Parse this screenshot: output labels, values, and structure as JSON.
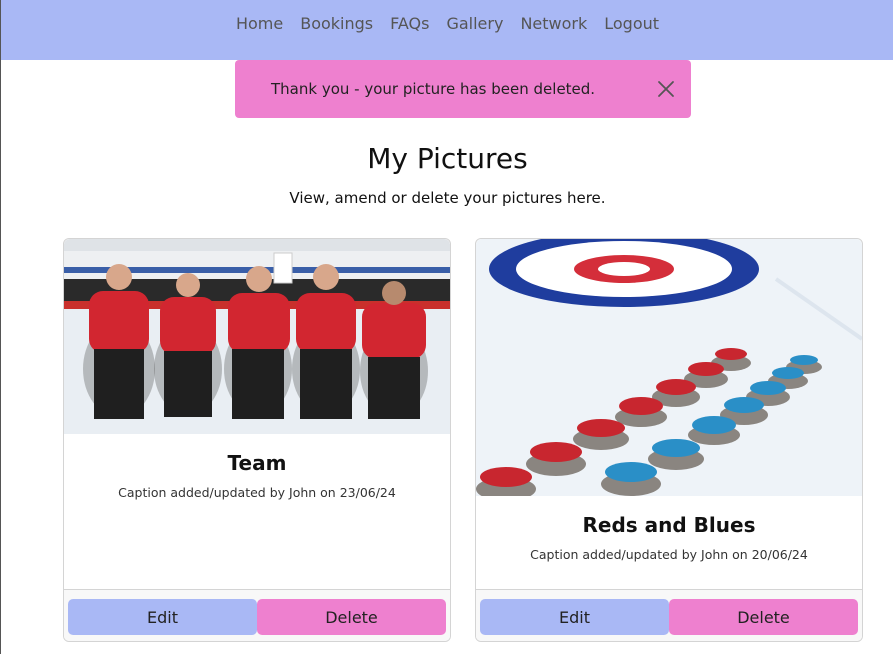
{
  "nav": {
    "items": [
      {
        "label": "Home"
      },
      {
        "label": "Bookings"
      },
      {
        "label": "FAQs"
      },
      {
        "label": "Gallery"
      },
      {
        "label": "Network"
      },
      {
        "label": "Logout"
      }
    ]
  },
  "alert": {
    "message": "Thank you - your picture has been deleted.",
    "close_icon": "close-icon"
  },
  "page": {
    "title": "My Pictures",
    "subtitle": "View, amend or delete your pictures here."
  },
  "cards": [
    {
      "title": "Team",
      "caption": "Caption added/updated by John on 23/06/24",
      "edit_label": "Edit",
      "delete_label": "Delete"
    },
    {
      "title": "Reds and Blues",
      "caption": "Caption added/updated by John on 20/06/24",
      "edit_label": "Edit",
      "delete_label": "Delete"
    }
  ],
  "colors": {
    "nav_bg": "#a9b8f5",
    "alert_bg": "#ee80cf",
    "edit_btn": "#a9b8f5",
    "delete_btn": "#ee80cf"
  }
}
